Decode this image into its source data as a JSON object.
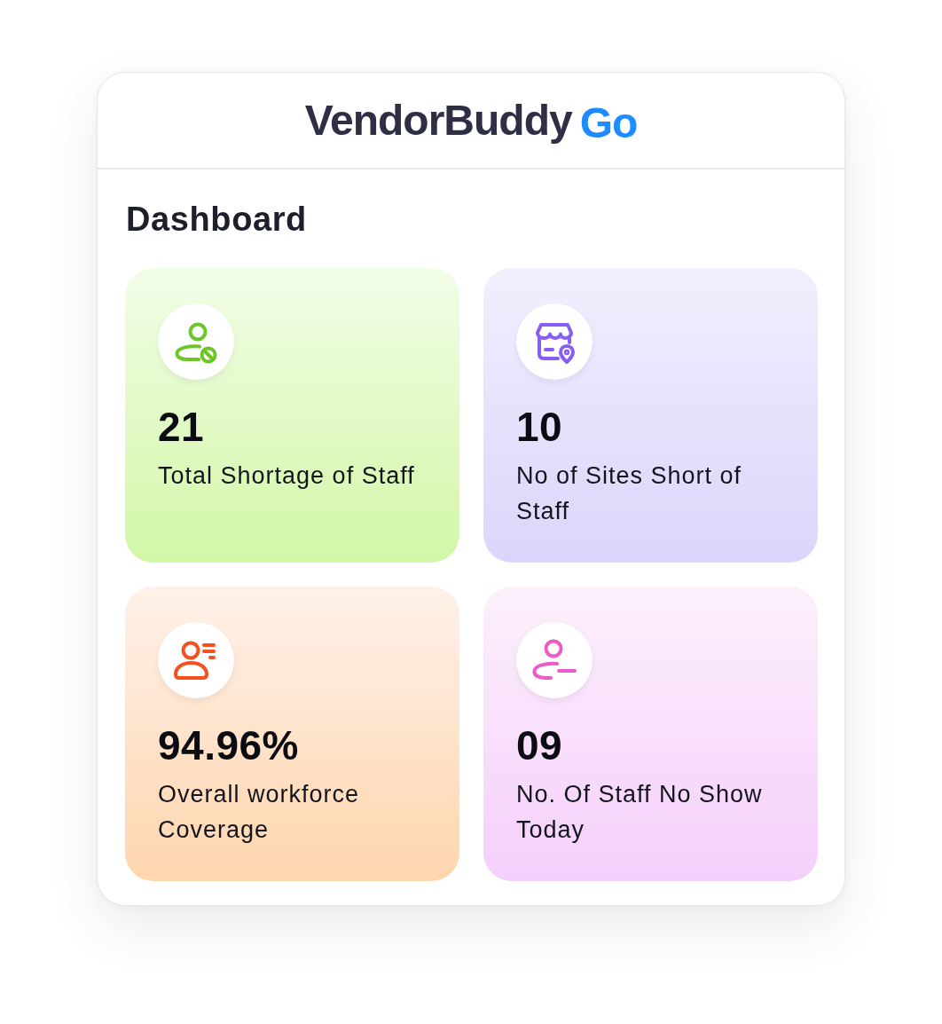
{
  "header": {
    "brand": "VendorBuddy",
    "brand_suffix": "Go"
  },
  "page_title": "Dashboard",
  "tiles": [
    {
      "kind": "person-blocked",
      "color": "#6cc628",
      "value": "21",
      "label": "Total Shortage of Staff"
    },
    {
      "kind": "store-pin",
      "color": "#8a5cf6",
      "value": "10",
      "label": "No of Sites Short of Staff"
    },
    {
      "kind": "person-list",
      "color": "#f4511e",
      "value": "94.96%",
      "label": "Overall workforce Coverage"
    },
    {
      "kind": "person-minus",
      "color": "#ea5cc6",
      "value": "09",
      "label": "No. Of Staff No Show Today"
    }
  ]
}
